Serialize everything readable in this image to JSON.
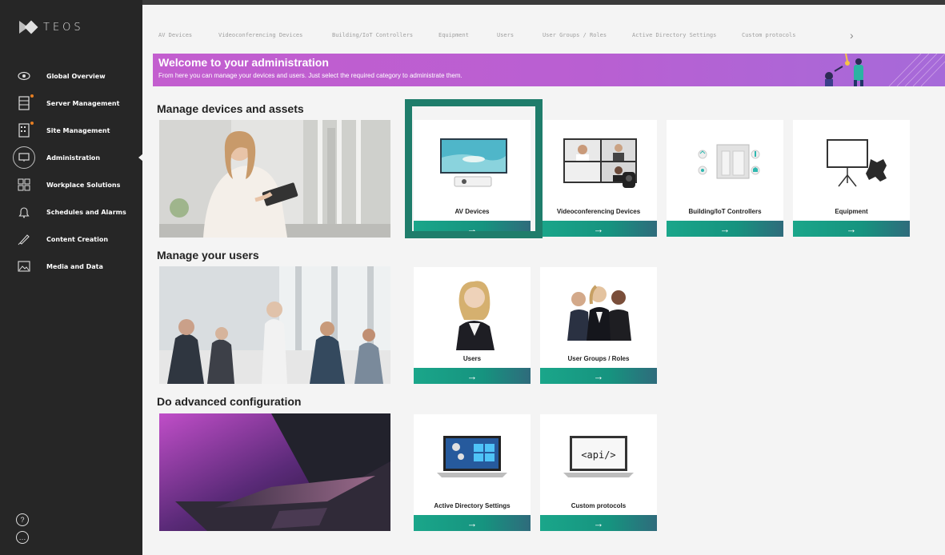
{
  "app": {
    "logo_text": "TEOS"
  },
  "sidebar": {
    "items": [
      {
        "label": "Global Overview",
        "icon": "eye-icon"
      },
      {
        "label": "Server Management",
        "icon": "server-icon"
      },
      {
        "label": "Site Management",
        "icon": "building-icon"
      },
      {
        "label": "Administration",
        "icon": "monitor-icon"
      },
      {
        "label": "Workplace Solutions",
        "icon": "grid-icon"
      },
      {
        "label": "Schedules and Alarms",
        "icon": "bell-icon"
      },
      {
        "label": "Content Creation",
        "icon": "pen-icon"
      },
      {
        "label": "Media and Data",
        "icon": "image-icon"
      }
    ],
    "help_glyph": "?",
    "chat_glyph": "…"
  },
  "tabs": [
    "AV Devices",
    "Videoconferencing Devices",
    "Building/IoT Controllers",
    "Equipment",
    "Users",
    "User Groups / Roles",
    "Active Directory Settings",
    "Custom protocols"
  ],
  "tab_next_glyph": "›",
  "banner": {
    "title": "Welcome to your administration",
    "subtitle": "From here you can manage your devices and users. Just select the required category to administrate them."
  },
  "sections": {
    "devices": "Manage devices and assets",
    "users": "Manage your users",
    "advanced": "Do advanced configuration"
  },
  "cards": {
    "av": "AV Devices",
    "vc": "Videoconferencing Devices",
    "iot": "Building/IoT Controllers",
    "equipment": "Equipment",
    "users": "Users",
    "groups": "User Groups / Roles",
    "ad": "Active Directory Settings",
    "custom": "Custom protocols",
    "api_text": "<api/>",
    "arrow": "→"
  },
  "colors": {
    "accent": "#1aa68a",
    "banner": "#c35ecf",
    "selected": "#1f7d6b"
  }
}
